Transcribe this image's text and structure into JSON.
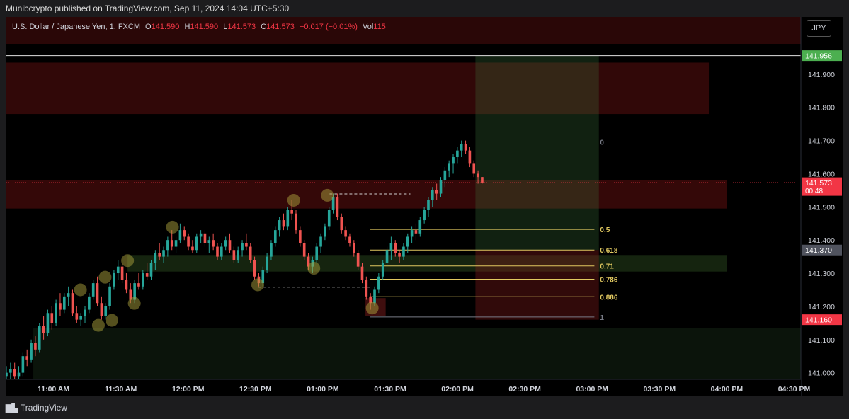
{
  "header": {
    "published": "Munibcrypto published on TradingView.com, Sep 11, 2024 14:04 UTC+5:30"
  },
  "legend": {
    "symbol": "U.S. Dollar / Japanese Yen, 1, FXCM",
    "o_label": "O",
    "o": "141.590",
    "h_label": "H",
    "h": "141.590",
    "l_label": "L",
    "l": "141.573",
    "c_label": "C",
    "c": "141.573",
    "change": "−0.017 (−0.01%)",
    "vol_label": "Vol",
    "vol": "115"
  },
  "currency": "JPY",
  "footer": {
    "brand": "TradingView"
  },
  "colors": {
    "up": "#26a69a",
    "down": "#ef5350",
    "background": "#000000",
    "fib": "#e0c860"
  },
  "chart_data": {
    "type": "candlestick",
    "title": "U.S. Dollar / Japanese Yen, 1, FXCM",
    "y_ticks": [
      "141.000",
      "141.100",
      "141.200",
      "141.300",
      "141.400",
      "141.500",
      "141.600",
      "141.700",
      "141.800",
      "141.900"
    ],
    "ylim": [
      140.98,
      142.0
    ],
    "x_ticks": [
      "11:00 AM",
      "11:30 AM",
      "12:00 PM",
      "12:30 PM",
      "01:00 PM",
      "01:30 PM",
      "02:00 PM",
      "02:30 PM",
      "03:00 PM",
      "03:30 PM",
      "04:00 PM",
      "04:30 PM"
    ],
    "x_range": [
      "10:39",
      "16:33"
    ],
    "price_labels": [
      {
        "value": "141.956",
        "color": "#4caf50"
      },
      {
        "value": "141.573",
        "color": "#f23645",
        "sub": "00:48"
      },
      {
        "value": "141.370",
        "color": "#50535e"
      },
      {
        "value": "141.160",
        "color": "#f23645"
      }
    ],
    "last_price": 141.573,
    "horizontal_line": 141.956,
    "zones": [
      {
        "kind": "supply",
        "t0": "10:39",
        "t1": "15:52",
        "p0": 141.78,
        "p1": 141.935,
        "color": "rgba(130,20,20,0.38)"
      },
      {
        "kind": "supply",
        "t0": "10:39",
        "t1": "16:00",
        "p0": 141.495,
        "p1": 141.58,
        "color": "rgba(130,20,20,0.40)"
      },
      {
        "kind": "demand",
        "t0": "11:33",
        "t1": "16:00",
        "p0": 141.305,
        "p1": 141.355,
        "color": "rgba(70,120,50,0.30)"
      },
      {
        "kind": "demand",
        "t0": "10:51",
        "t1": "16:33",
        "p0": 140.98,
        "p1": 141.135,
        "color": "rgba(50,90,50,0.22)"
      },
      {
        "kind": "target",
        "t0": "14:08",
        "t1": "15:03",
        "p0": 141.37,
        "p1": 141.956,
        "color": "rgba(60,120,60,0.28)"
      },
      {
        "kind": "stop",
        "t0": "14:08",
        "t1": "15:03",
        "p0": 141.16,
        "p1": 141.37,
        "color": "rgba(140,30,30,0.35)"
      },
      {
        "kind": "order-block",
        "t0": "13:19",
        "t1": "13:28",
        "p0": 141.17,
        "p1": 141.225,
        "color": "rgba(140,30,30,0.45)"
      }
    ],
    "fibonacci": {
      "t0": "13:21",
      "t1": "15:01",
      "levels": [
        {
          "label": "0",
          "price": 141.696,
          "color": "#787b86"
        },
        {
          "label": "0.5",
          "price": 141.432,
          "color": "#e0c860"
        },
        {
          "label": "0.618",
          "price": 141.37,
          "color": "#e0c860"
        },
        {
          "label": "0.71",
          "price": 141.322,
          "color": "#e0c860"
        },
        {
          "label": "0.786",
          "price": 141.282,
          "color": "#e0c860"
        },
        {
          "label": "0.886",
          "price": 141.229,
          "color": "#e0c860"
        },
        {
          "label": "1",
          "price": 141.168,
          "color": "#787b86"
        }
      ]
    },
    "dashed_lines": [
      {
        "t0": "13:03",
        "t1": "13:39",
        "price": 141.539
      },
      {
        "t0": "12:31",
        "t1": "13:21",
        "price": 141.258
      }
    ],
    "swing_markers": [
      {
        "t": "11:12",
        "price": 141.25
      },
      {
        "t": "11:20",
        "price": 141.143
      },
      {
        "t": "11:23",
        "price": 141.288
      },
      {
        "t": "11:26",
        "price": 141.158
      },
      {
        "t": "11:33",
        "price": 141.338
      },
      {
        "t": "11:36",
        "price": 141.209
      },
      {
        "t": "11:53",
        "price": 141.439
      },
      {
        "t": "12:31",
        "price": 141.265
      },
      {
        "t": "12:47",
        "price": 141.52
      },
      {
        "t": "12:56",
        "price": 141.315
      },
      {
        "t": "13:02",
        "price": 141.535
      },
      {
        "t": "13:22",
        "price": 141.195
      }
    ],
    "candles": [
      [
        140.99,
        141.02,
        140.97,
        141.0
      ],
      [
        141.0,
        141.03,
        140.98,
        141.01
      ],
      [
        141.01,
        141.03,
        140.98,
        140.99
      ],
      [
        140.99,
        141.02,
        140.97,
        141.0
      ],
      [
        141.0,
        141.06,
        140.99,
        141.05
      ],
      [
        141.05,
        141.07,
        141.02,
        141.04
      ],
      [
        141.04,
        141.1,
        141.03,
        141.09
      ],
      [
        141.09,
        141.11,
        141.05,
        141.07
      ],
      [
        141.07,
        141.15,
        141.06,
        141.14
      ],
      [
        141.14,
        141.17,
        141.1,
        141.12
      ],
      [
        141.12,
        141.19,
        141.11,
        141.18
      ],
      [
        141.18,
        141.2,
        141.13,
        141.15
      ],
      [
        141.15,
        141.22,
        141.14,
        141.21
      ],
      [
        141.21,
        141.24,
        141.17,
        141.19
      ],
      [
        141.19,
        141.24,
        141.18,
        141.23
      ],
      [
        141.23,
        141.26,
        141.2,
        141.24
      ],
      [
        141.24,
        141.25,
        141.17,
        141.18
      ],
      [
        141.18,
        141.2,
        141.15,
        141.16
      ],
      [
        141.16,
        141.18,
        141.14,
        141.17
      ],
      [
        141.17,
        141.2,
        141.15,
        141.19
      ],
      [
        141.19,
        141.24,
        141.18,
        141.23
      ],
      [
        141.23,
        141.28,
        141.22,
        141.27
      ],
      [
        141.27,
        141.29,
        141.2,
        141.21
      ],
      [
        141.21,
        141.23,
        141.16,
        141.17
      ],
      [
        141.17,
        141.21,
        141.16,
        141.2
      ],
      [
        141.2,
        141.27,
        141.19,
        141.26
      ],
      [
        141.26,
        141.31,
        141.25,
        141.3
      ],
      [
        141.3,
        141.34,
        141.28,
        141.32
      ],
      [
        141.32,
        141.33,
        141.27,
        141.28
      ],
      [
        141.28,
        141.3,
        141.24,
        141.25
      ],
      [
        141.25,
        141.27,
        141.21,
        141.22
      ],
      [
        141.22,
        141.28,
        141.21,
        141.27
      ],
      [
        141.27,
        141.3,
        141.25,
        141.26
      ],
      [
        141.26,
        141.31,
        141.25,
        141.3
      ],
      [
        141.3,
        141.33,
        141.28,
        141.29
      ],
      [
        141.29,
        141.34,
        141.28,
        141.33
      ],
      [
        141.33,
        141.37,
        141.31,
        141.36
      ],
      [
        141.36,
        141.39,
        141.34,
        141.35
      ],
      [
        141.35,
        141.38,
        141.33,
        141.37
      ],
      [
        141.37,
        141.41,
        141.35,
        141.4
      ],
      [
        141.4,
        141.43,
        141.37,
        141.38
      ],
      [
        141.38,
        141.41,
        141.36,
        141.4
      ],
      [
        141.4,
        141.45,
        141.39,
        141.43
      ],
      [
        141.43,
        141.44,
        141.4,
        141.41
      ],
      [
        141.41,
        141.42,
        141.37,
        141.38
      ],
      [
        141.38,
        141.4,
        141.36,
        141.37
      ],
      [
        141.37,
        141.42,
        141.36,
        141.41
      ],
      [
        141.41,
        141.43,
        141.39,
        141.42
      ],
      [
        141.42,
        141.43,
        141.38,
        141.39
      ],
      [
        141.39,
        141.41,
        141.36,
        141.4
      ],
      [
        141.4,
        141.42,
        141.37,
        141.38
      ],
      [
        141.38,
        141.39,
        141.34,
        141.35
      ],
      [
        141.35,
        141.39,
        141.34,
        141.38
      ],
      [
        141.38,
        141.41,
        141.37,
        141.4
      ],
      [
        141.4,
        141.42,
        141.36,
        141.37
      ],
      [
        141.37,
        141.38,
        141.33,
        141.34
      ],
      [
        141.34,
        141.38,
        141.33,
        141.37
      ],
      [
        141.37,
        141.4,
        141.35,
        141.39
      ],
      [
        141.39,
        141.42,
        141.37,
        141.38
      ],
      [
        141.38,
        141.39,
        141.33,
        141.34
      ],
      [
        141.34,
        141.35,
        141.28,
        141.29
      ],
      [
        141.29,
        141.3,
        141.26,
        141.27
      ],
      [
        141.27,
        141.32,
        141.26,
        141.31
      ],
      [
        141.31,
        141.36,
        141.3,
        141.35
      ],
      [
        141.35,
        141.4,
        141.34,
        141.39
      ],
      [
        141.39,
        141.44,
        141.38,
        141.43
      ],
      [
        141.43,
        141.47,
        141.41,
        141.46
      ],
      [
        141.46,
        141.48,
        141.43,
        141.44
      ],
      [
        141.44,
        141.5,
        141.43,
        141.49
      ],
      [
        141.49,
        141.52,
        141.46,
        141.48
      ],
      [
        141.48,
        141.49,
        141.42,
        141.43
      ],
      [
        141.43,
        141.44,
        141.38,
        141.39
      ],
      [
        141.39,
        141.4,
        141.34,
        141.35
      ],
      [
        141.35,
        141.36,
        141.31,
        141.32
      ],
      [
        141.32,
        141.35,
        141.3,
        141.34
      ],
      [
        141.34,
        141.39,
        141.33,
        141.38
      ],
      [
        141.38,
        141.42,
        141.36,
        141.41
      ],
      [
        141.41,
        141.45,
        141.4,
        141.44
      ],
      [
        141.44,
        141.5,
        141.43,
        141.49
      ],
      [
        141.49,
        141.54,
        141.48,
        141.53
      ],
      [
        141.53,
        141.54,
        141.46,
        141.47
      ],
      [
        141.47,
        141.48,
        141.42,
        141.43
      ],
      [
        141.43,
        141.44,
        141.4,
        141.41
      ],
      [
        141.41,
        141.42,
        141.38,
        141.39
      ],
      [
        141.39,
        141.4,
        141.35,
        141.36
      ],
      [
        141.36,
        141.37,
        141.31,
        141.32
      ],
      [
        141.32,
        141.33,
        141.27,
        141.28
      ],
      [
        141.28,
        141.29,
        141.22,
        141.23
      ],
      [
        141.23,
        141.24,
        141.19,
        141.21
      ],
      [
        141.21,
        141.26,
        141.2,
        141.25
      ],
      [
        141.25,
        141.3,
        141.24,
        141.29
      ],
      [
        141.29,
        141.34,
        141.28,
        141.33
      ],
      [
        141.33,
        141.38,
        141.32,
        141.37
      ],
      [
        141.37,
        141.41,
        141.34,
        141.39
      ],
      [
        141.39,
        141.4,
        141.35,
        141.36
      ],
      [
        141.36,
        141.37,
        141.33,
        141.35
      ],
      [
        141.35,
        141.39,
        141.34,
        141.38
      ],
      [
        141.38,
        141.42,
        141.36,
        141.41
      ],
      [
        141.41,
        141.44,
        141.39,
        141.43
      ],
      [
        141.43,
        141.45,
        141.4,
        141.42
      ],
      [
        141.42,
        141.47,
        141.41,
        141.46
      ],
      [
        141.46,
        141.5,
        141.45,
        141.49
      ],
      [
        141.49,
        141.53,
        141.47,
        141.52
      ],
      [
        141.52,
        141.56,
        141.5,
        141.55
      ],
      [
        141.55,
        141.57,
        141.52,
        141.54
      ],
      [
        141.54,
        141.59,
        141.53,
        141.58
      ],
      [
        141.58,
        141.62,
        141.56,
        141.61
      ],
      [
        141.61,
        141.64,
        141.59,
        141.63
      ],
      [
        141.63,
        141.66,
        141.6,
        141.65
      ],
      [
        141.65,
        141.68,
        141.63,
        141.67
      ],
      [
        141.67,
        141.7,
        141.65,
        141.69
      ],
      [
        141.69,
        141.7,
        141.66,
        141.67
      ],
      [
        141.67,
        141.68,
        141.62,
        141.63
      ],
      [
        141.63,
        141.64,
        141.59,
        141.6
      ],
      [
        141.6,
        141.61,
        141.57,
        141.59
      ],
      [
        141.59,
        141.59,
        141.57,
        141.573
      ]
    ]
  }
}
